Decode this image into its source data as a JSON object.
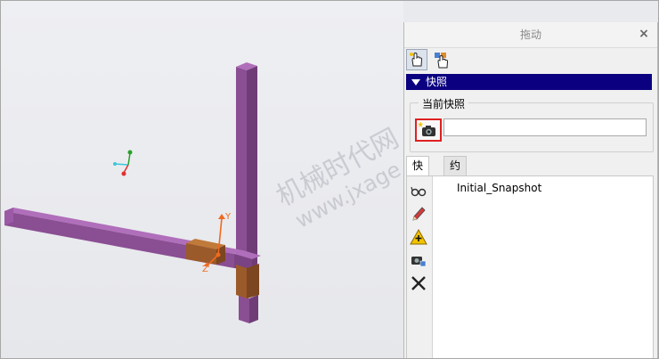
{
  "panel": {
    "title": "拖动",
    "close_symbol": "×",
    "toolbar": [
      {
        "icon": "drag-hand-icon",
        "active": true
      },
      {
        "icon": "drag-components-icon",
        "active": false
      }
    ],
    "section_title": "快照",
    "current_snapshot_label": "当前快照",
    "snapshot_name_value": "",
    "tabs": [
      {
        "label": "快照",
        "active": true
      },
      {
        "label": "约束",
        "active": false
      }
    ],
    "side_tools": [
      "glasses-icon",
      "pencil-icon",
      "warning-add-icon",
      "camera-update-icon",
      "delete-icon"
    ],
    "snapshots": [
      "Initial_Snapshot"
    ]
  },
  "viewport": {
    "axis_label_y": "Y",
    "axis_label_z": "Z",
    "watermark_line1": "机械时代网",
    "watermark_line2": "www.jxage.com"
  },
  "colors": {
    "beam": "#8b4f93",
    "bracket": "#9b5a2a",
    "section_header": "#0b0080",
    "highlight": "#e02020"
  }
}
